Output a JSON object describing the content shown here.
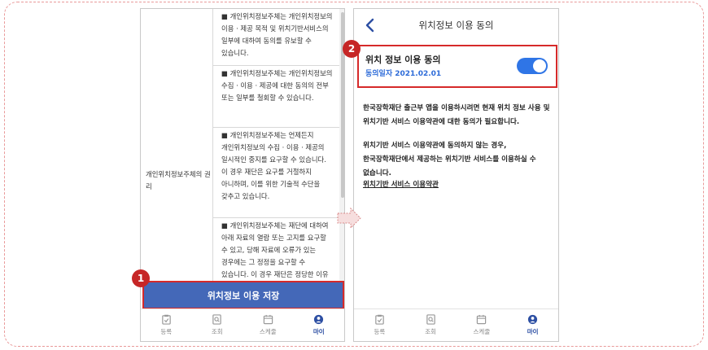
{
  "left_screen": {
    "row_label": "개인위치정보주체의 권리",
    "terms_cells": [
      "■ 개인위치정보주체는 개인위치정보의 이용 · 제공 목적 및 위치기반서비스의 일부에 대하여 동의를 유보할 수 있습니다.",
      "■ 개인위치정보주체는 개인위치정보의 수집 · 이용 · 제공에 대한 동의의 전부 또는 일부를 철회할 수 있습니다.",
      "■ 개인위치정보주체는 언제든지 개인위치정보의 수집 · 이용 · 제공의 일시적인 중지를 요구할 수 있습니다. 이 경우 재단은 요구를 거절하지 아니하며, 이를 위한 기술적 수단을 갖추고 있습니다.",
      "■ 개인위치정보주체는 재단에 대하여 아래 자료의 열람 또는 고지를 요구할 수 있고, 당해 자료에 오류가 있는 경우에는 그 정정을 요구할 수 있습니다. 이 경우 재단은 정당한 이유 없이 요구를 거절하지 아니합니다."
    ],
    "save_button_label": "위치정보 이용 저장"
  },
  "right_screen": {
    "header_title": "위치정보 이용 동의",
    "consent_title": "위치 정보 이용 동의",
    "consent_date": "동의일자 2021.02.01",
    "toggle_on": true,
    "paragraph_1": "한국장학재단 출근부 앱을 이용하시려면 현재 위치 정보 사용 및 위치기반 서비스 이용약관에 대한 동의가 필요합니다.",
    "paragraph_2": "위치기반 서비스 이용약관에 동의하지 않는 경우, 한국장학재단에서 제공하는 위치기반 서비스를 이용하실 수 없습니다.",
    "terms_link": "위치기반 서비스 이용약관"
  },
  "tabbar": {
    "tabs": [
      {
        "label": "등록",
        "icon": "register-icon",
        "active": false
      },
      {
        "label": "조회",
        "icon": "search-doc-icon",
        "active": false
      },
      {
        "label": "스케줄",
        "icon": "calendar-icon",
        "active": false
      },
      {
        "label": "마이",
        "icon": "user-icon",
        "active": true
      }
    ]
  },
  "callouts": {
    "badge_1": "1",
    "badge_2": "2"
  },
  "colors": {
    "primary_blue": "#4468b8",
    "toggle_blue": "#2f75e6",
    "highlight_red": "#d62a2a",
    "date_blue": "#2d6bd8"
  }
}
